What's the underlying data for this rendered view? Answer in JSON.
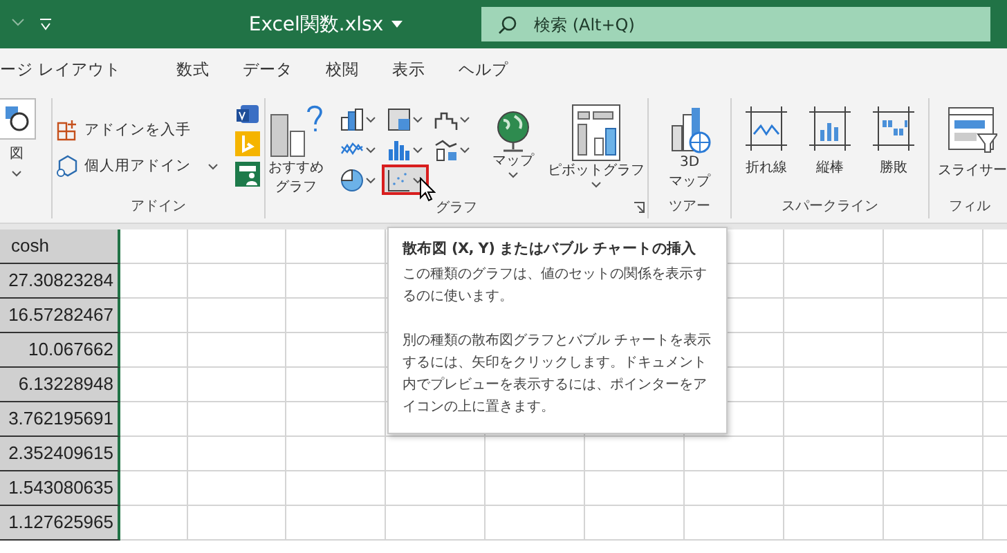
{
  "title_bar": {
    "title": "Excel関数.xlsx",
    "search": {
      "placeholder": "検索 (Alt+Q)"
    }
  },
  "tabs": [
    {
      "label": "ージ レイアウト",
      "selected": false
    },
    {
      "label": "数式",
      "selected": false
    },
    {
      "label": "データ",
      "selected": false
    },
    {
      "label": "校閲",
      "selected": false
    },
    {
      "label": "表示",
      "selected": false
    },
    {
      "label": "ヘルプ",
      "selected": false
    }
  ],
  "ribbon": {
    "groups": [
      {
        "kind": "shapes",
        "items": [
          {
            "label": "図"
          }
        ]
      },
      {
        "kind": "addins",
        "label": "アドイン",
        "items": [
          {
            "label": "アドインを入手"
          },
          {
            "label": "個人用アドイン"
          }
        ]
      },
      {
        "kind": "charts",
        "label": "グラフ",
        "recommended": [
          "おすすめ",
          "グラフ"
        ],
        "small": [
          {
            "selected": false
          },
          {
            "selected": false
          },
          {
            "selected": false
          },
          {
            "selected": false
          },
          {
            "selected": false
          },
          {
            "selected": false
          },
          {
            "selected": false
          },
          {
            "selected": true
          }
        ],
        "items": [
          {
            "label": "マップ"
          },
          {
            "label": "ピボットグラフ"
          }
        ]
      },
      {
        "kind": "tours",
        "label": "ツアー",
        "items": [
          {
            "label": [
              "3D",
              "マップ"
            ]
          }
        ]
      },
      {
        "kind": "sparklines",
        "label": "スパークライン",
        "items": [
          {
            "label": "折れ線"
          },
          {
            "label": "縦棒"
          },
          {
            "label": "勝敗"
          }
        ]
      },
      {
        "kind": "filters",
        "label": "フィル",
        "items": [
          {
            "label": "スライサー"
          }
        ]
      }
    ]
  },
  "sheet": {
    "cells": [
      "cosh",
      "27.30823284",
      "16.57282467",
      "10.067662",
      "6.13228948",
      "3.762195691",
      "2.352409615",
      "1.543080635",
      "1.127625965"
    ]
  },
  "tooltip": {
    "title": "散布図 (X, Y) またはバブル チャートの挿入",
    "paragraphs": [
      "この種類のグラフは、値のセットの関係を表示するのに使います。",
      "別の種類の散布図グラフとバブル チャートを表示するには、矢印をクリックします。ドキュメント内でプレビューを表示するには、ポインターをアイコンの上に置きます。"
    ]
  }
}
